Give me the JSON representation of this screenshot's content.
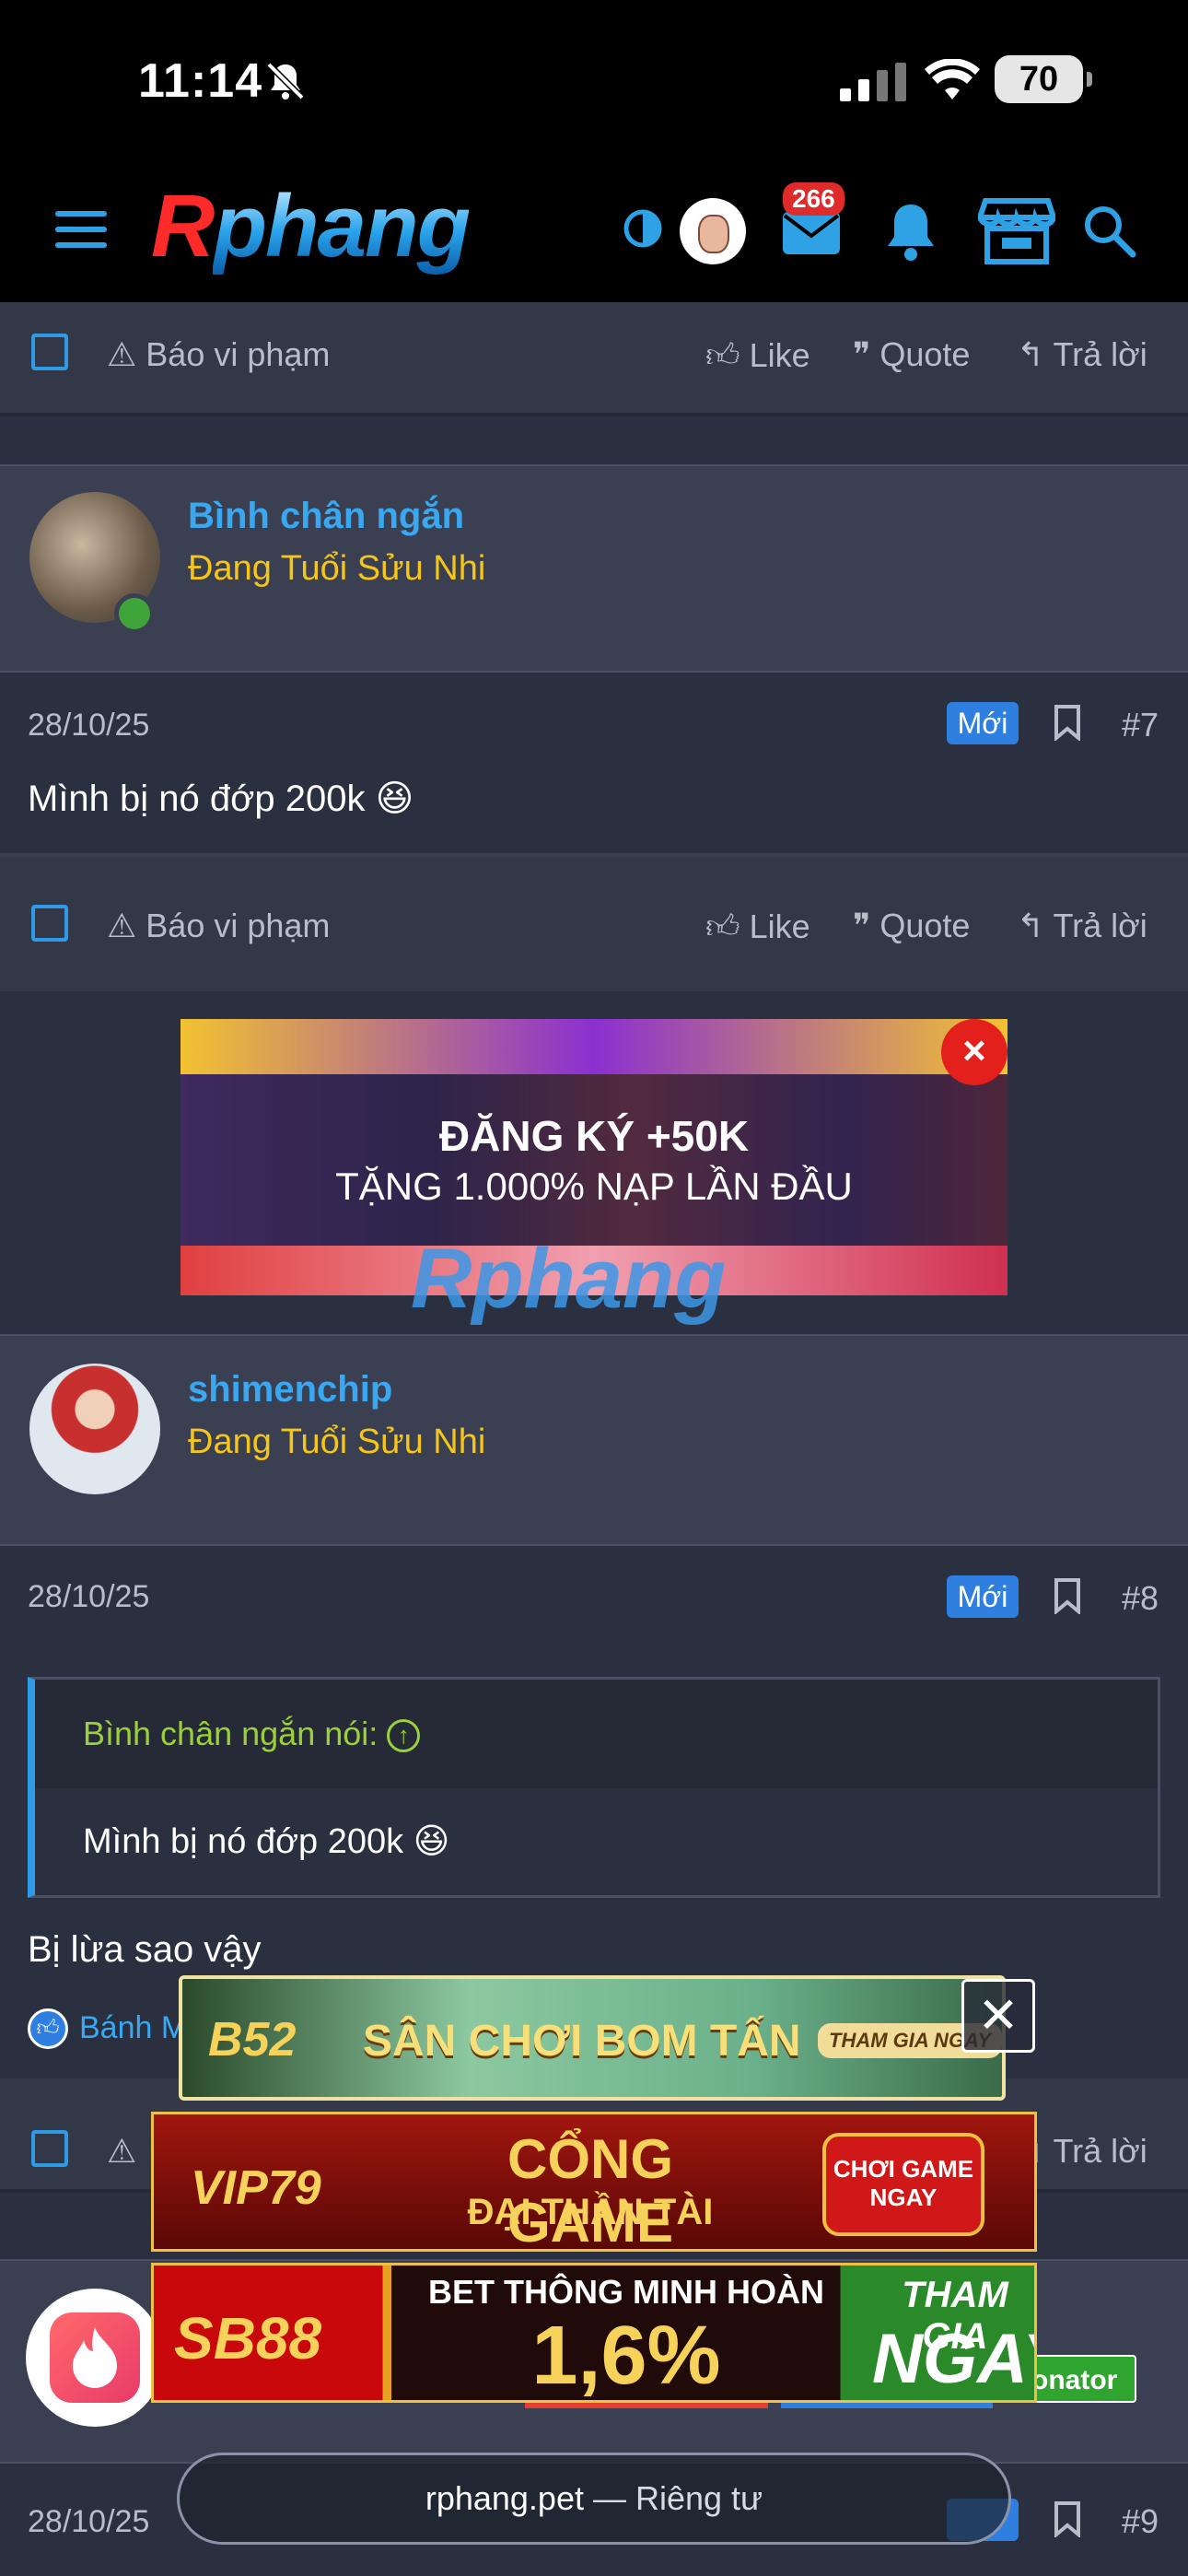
{
  "status": {
    "time": "11:14",
    "battery": "70"
  },
  "topbar": {
    "logo_r": "R",
    "logo_rest": "phang",
    "inbox_badge": "266"
  },
  "actions": {
    "report": "Báo vi phạm",
    "like": "Like",
    "quote": "Quote",
    "reply": "Trả lời"
  },
  "posts": [
    {
      "user": "Bình chân ngắn",
      "title": "Đang Tuổi Sửu Nhi",
      "date": "28/10/25",
      "badge": "Mới",
      "num": "#7",
      "text": "Mình bị nó đớp 200k 😆"
    },
    {
      "user": "shimenchip",
      "title": "Đang Tuổi Sửu Nhi",
      "date": "28/10/25",
      "badge": "Mới",
      "num": "#8",
      "quote_head": "Bình chân ngắn nói:",
      "quote_body": "Mình bị nó đớp 200k 😆",
      "text": "Bị lừa sao vậy",
      "reaction": "Bánh M"
    },
    {
      "date": "28/10/25",
      "num": "#9",
      "role": "onator"
    }
  ],
  "ad_banner": {
    "line1": "ĐĂNG KÝ +50K",
    "line2": "TẶNG 1.000% NẠP LẦN ĐẦU",
    "watermark": "Rphang",
    "close": "×"
  },
  "floating_ads": {
    "b52": {
      "logo": "B52",
      "text": "SÂN CHƠI BOM TẤN",
      "cta": "THAM GIA NGAY"
    },
    "vip79": {
      "logo": "VIP79",
      "text1": "CỔNG GAME",
      "text2": "ĐẠI THẦN TÀI",
      "cta1": "CHƠI GAME",
      "cta2": "NGAY"
    },
    "sb88": {
      "logo": "SB88",
      "text1": "BET THÔNG MINH HOÀN",
      "text2": "1,6%",
      "cta1": "THAM GIA",
      "cta2": "NGAY"
    },
    "close": "✕"
  },
  "browser": {
    "domain": "rphang.pet",
    "suffix": " — Riêng tư"
  }
}
